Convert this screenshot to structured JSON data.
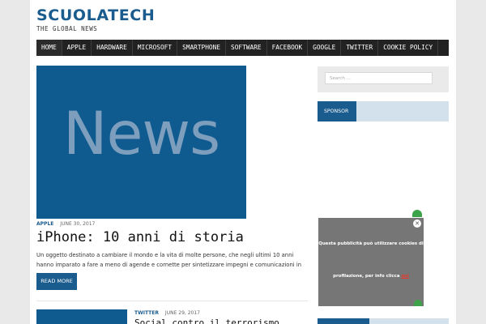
{
  "site": {
    "title": "SCUOLATECH",
    "tagline": "THE GLOBAL NEWS"
  },
  "nav": {
    "items": [
      "HOME",
      "APPLE",
      "HARDWARE",
      "MICROSOFT",
      "SMARTPHONE",
      "SOFTWARE",
      "FACEBOOK",
      "GOOGLE",
      "TWITTER",
      "COOKIE POLICY"
    ]
  },
  "featured": {
    "image_text": "News",
    "category": "APPLE",
    "date": "JUNE 30, 2017",
    "title": "iPhone: 10 anni di storia",
    "excerpt": "Un oggetto destinato a cambiare il mondo e la vita di molte persone, che negli ultimi 10 anni hanno imparato a fare a meno di agende e cornette per sintetizzare impegni e comunicazioni in uno…",
    "read_more": "READ MORE"
  },
  "second_post": {
    "category": "TWITTER",
    "date": "JUNE 29, 2017",
    "title": "Social contro il terrorismo"
  },
  "sidebar": {
    "search_placeholder": "Search ...",
    "sponsor_label": "SPONSOR"
  },
  "ad": {
    "line1": "Questa pubblicità può utilizzare cookies di",
    "line2_prefix": "profilazione, per info clicca ",
    "line2_link": "qui",
    "close_glyph": "✕"
  },
  "colors": {
    "brand": "#1b5c8f",
    "nav_bg": "#222222",
    "ad_bg": "#767676",
    "ad_link": "#e63a2e",
    "accent_green": "#3da34b"
  }
}
